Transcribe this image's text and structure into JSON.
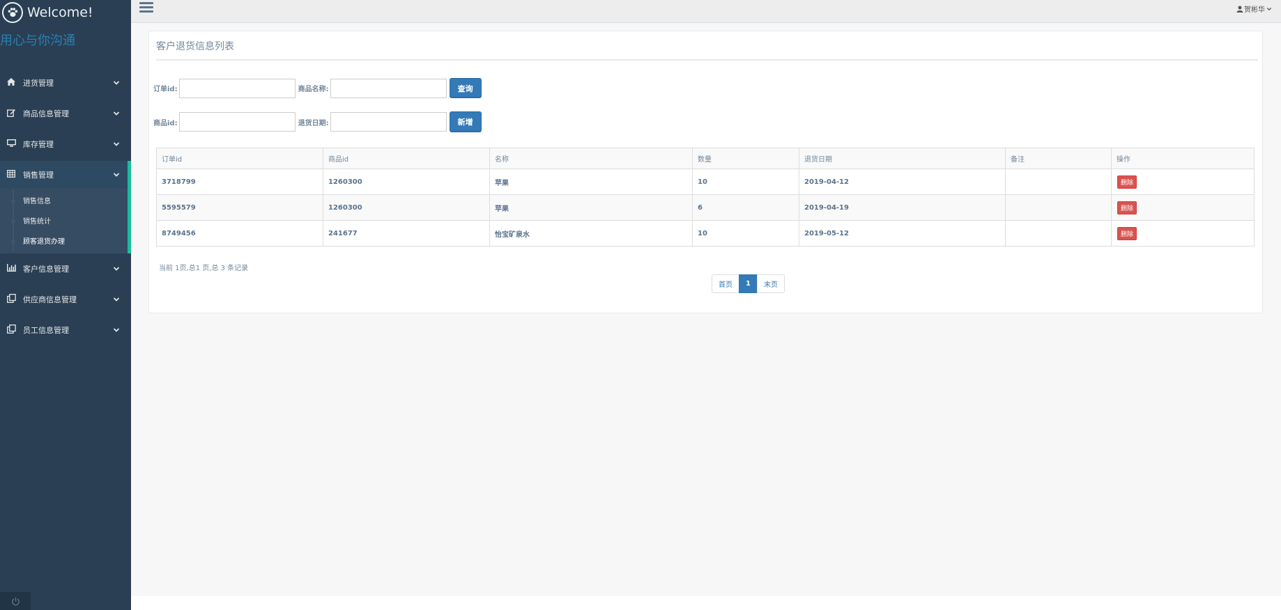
{
  "brand": {
    "title": "Welcome!",
    "slogan": "用心与你沟通",
    "icon": "paw-icon"
  },
  "sidebar": {
    "items": [
      {
        "label": "进货管理",
        "icon": "home-icon"
      },
      {
        "label": "商品信息管理",
        "icon": "edit-icon"
      },
      {
        "label": "库存管理",
        "icon": "desktop-icon"
      },
      {
        "label": "销售管理",
        "icon": "table-icon"
      },
      {
        "label": "客户信息管理",
        "icon": "bar-chart-icon"
      },
      {
        "label": "供应商信息管理",
        "icon": "clone-icon"
      },
      {
        "label": "员工信息管理",
        "icon": "clone-icon"
      }
    ],
    "sales_sub": [
      {
        "label": "销售信息"
      },
      {
        "label": "销售统计"
      },
      {
        "label": "顾客退货办理"
      }
    ]
  },
  "topbar": {
    "user": "贺彬华"
  },
  "panel": {
    "title": "客户退货信息列表"
  },
  "filters": {
    "order_id_label": "订单id:",
    "product_name_label": "商品名称:",
    "query_button": "查询",
    "product_id_label": "商品id:",
    "return_date_label": "退货日期:",
    "add_button": "新增"
  },
  "table": {
    "headers": [
      "订单id",
      "商品id",
      "名称",
      "数量",
      "退货日期",
      "备注",
      "操作"
    ],
    "rows": [
      {
        "order_id": "3718799",
        "product_id": "1260300",
        "name": "苹果",
        "qty": "10",
        "date": "2019-04-12",
        "note": "",
        "action": "删除"
      },
      {
        "order_id": "5595579",
        "product_id": "1260300",
        "name": "苹果",
        "qty": "6",
        "date": "2019-04-19",
        "note": "",
        "action": "删除"
      },
      {
        "order_id": "8749456",
        "product_id": "241677",
        "name": "怡宝矿泉水",
        "qty": "10",
        "date": "2019-05-12",
        "note": "",
        "action": "删除"
      }
    ]
  },
  "pagination": {
    "info": "当前 1页,总1 页,总 3 条记录",
    "first": "首页",
    "current": "1",
    "last": "末页"
  },
  "colors": {
    "sidebar": "#2a3f54",
    "accent": "#1abb9c",
    "primary": "#337ab7",
    "danger": "#d9534f"
  }
}
